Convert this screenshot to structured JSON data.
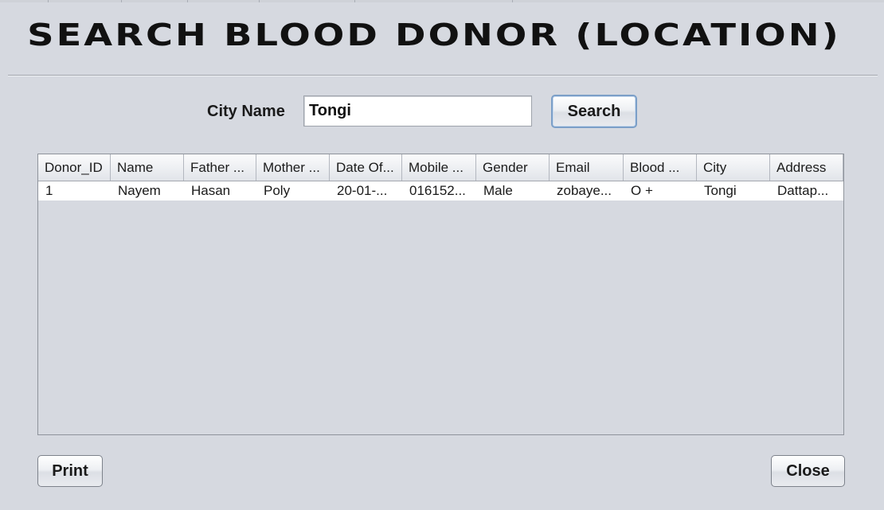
{
  "window": {
    "title": "SEARCH BLOOD DONOR (LOCATION)"
  },
  "search": {
    "label": "City Name",
    "value": "Tongi",
    "button_label": "Search"
  },
  "table": {
    "columns": [
      "Donor_ID",
      "Name",
      "Father ...",
      "Mother ...",
      "Date Of...",
      "Mobile ...",
      "Gender",
      "Email",
      "Blood ...",
      "City",
      "Address"
    ],
    "rows": [
      [
        "1",
        "Nayem",
        "Hasan",
        "Poly",
        "20-01-...",
        "016152...",
        "Male",
        "zobaye...",
        "O +",
        "Tongi",
        "Dattap..."
      ]
    ]
  },
  "footer": {
    "print_label": "Print",
    "close_label": "Close"
  }
}
